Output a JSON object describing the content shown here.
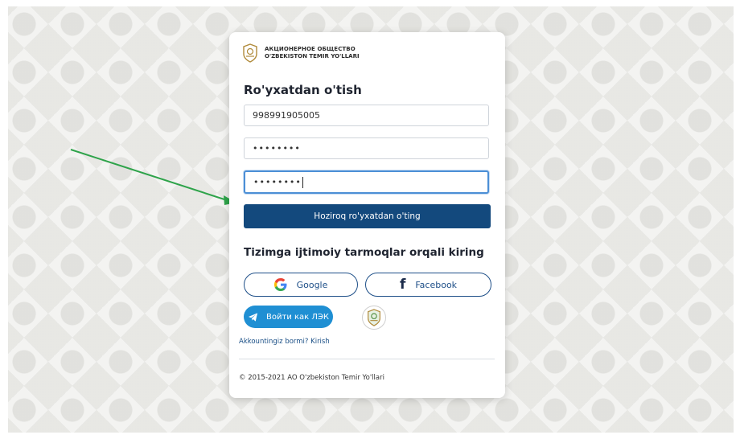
{
  "brand": {
    "line1": "АКЦИОНЕРНОЕ ОБЩЕСТВО",
    "line2": "O'ZBEKISTON TEMIR YO'LLARI"
  },
  "form": {
    "title": "Ro'yxatdan o'tish",
    "phone_value": "998991905005",
    "password_value": "••••••••",
    "password_confirm_value": "••••••••",
    "submit_label": "Hoziroq ro'yxatdan o'ting"
  },
  "social": {
    "title": "Tizimga ijtimoiy tarmoqlar orqali kiring",
    "google_label": "Google",
    "facebook_label": "Facebook",
    "telegram_label": "Войти как ЛЭК"
  },
  "footer": {
    "login_link": "Akkountingiz bormi? Kirish",
    "copyright": "© 2015-2021 AO O'zbekiston Temir Yo'llari"
  },
  "colors": {
    "primary": "#13497d",
    "telegram": "#1f8fd3",
    "arrow": "#2ea34a",
    "focus_border": "#4c8fd6"
  }
}
